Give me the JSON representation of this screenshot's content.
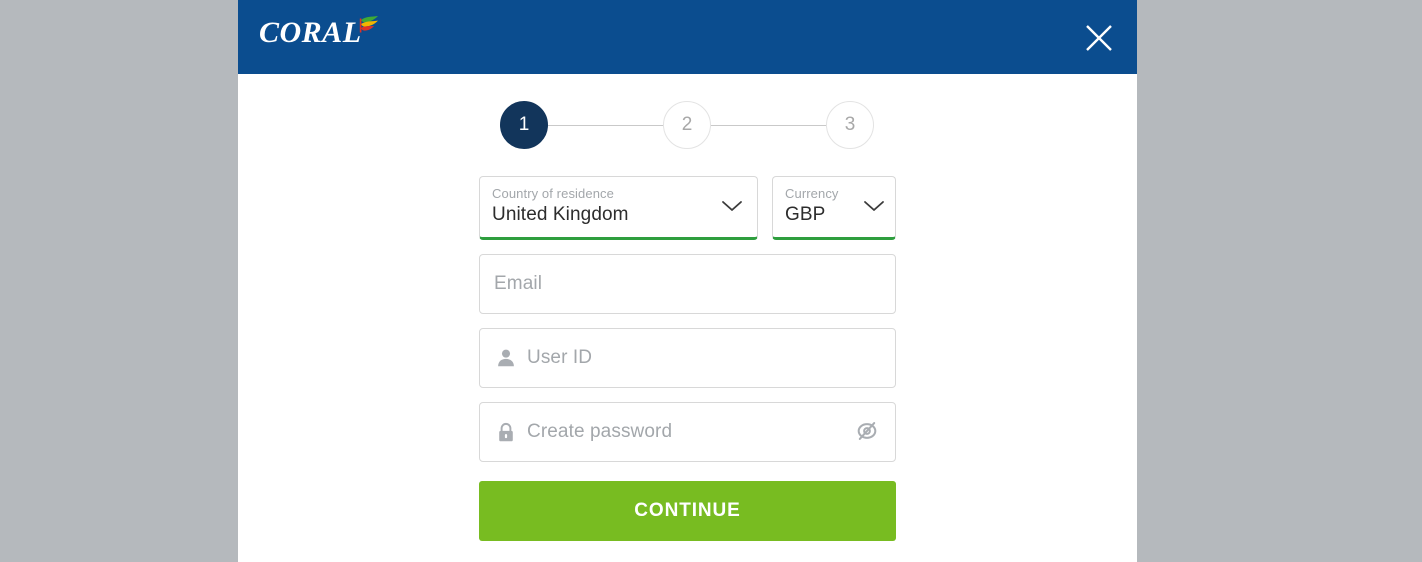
{
  "background": {
    "color": "#b5b9bd"
  },
  "modal": {
    "header": {
      "background_color": "#0b4d8f",
      "brand": {
        "wordmark": "CORAL",
        "flag_icon": "coral-flag-icon",
        "flag_colors": [
          "#3faa35",
          "#f2b500",
          "#e03127"
        ]
      },
      "close_icon": "close-icon"
    },
    "stepper": {
      "steps": [
        {
          "label": "1",
          "state": "active"
        },
        {
          "label": "2",
          "state": "inactive"
        },
        {
          "label": "3",
          "state": "inactive"
        }
      ],
      "active_color": "#12355b",
      "inactive_color": "#a8a8a8"
    },
    "form": {
      "country": {
        "label": "Country of residence",
        "value": "United Kingdom",
        "valid_color": "#2e9e3e",
        "chevron_icon": "chevron-down-icon"
      },
      "currency": {
        "label": "Currency",
        "value": "GBP",
        "valid_color": "#2e9e3e",
        "chevron_icon": "chevron-down-icon"
      },
      "email": {
        "placeholder": "Email",
        "value": ""
      },
      "user_id": {
        "placeholder": "User ID",
        "value": "",
        "icon": "user-icon"
      },
      "password": {
        "placeholder": "Create password",
        "value": "",
        "icon": "lock-icon",
        "toggle_icon": "eye-slash-icon"
      },
      "submit": {
        "label": "CONTINUE",
        "color": "#78bc21"
      }
    }
  }
}
